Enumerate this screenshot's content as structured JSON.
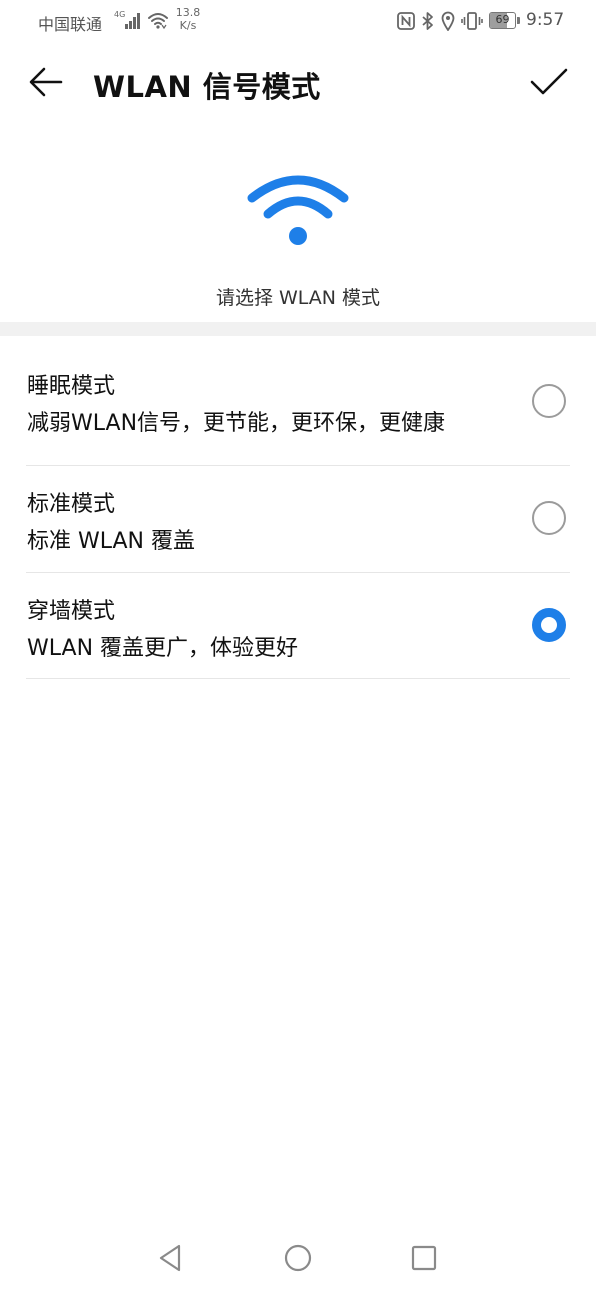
{
  "status_bar": {
    "carrier": "中国联通",
    "network_type": "4G",
    "speed_value": "13.8",
    "speed_unit": "K/s",
    "battery_level": "69",
    "battery_fraction": 0.69,
    "time": "9:57",
    "icons": [
      "signal-icon",
      "wifi-icon",
      "nfc-icon",
      "bluetooth-icon",
      "location-icon",
      "vibrate-icon",
      "battery-icon"
    ]
  },
  "header": {
    "title": "WLAN 信号模式"
  },
  "intro": {
    "hint": "请选择 WLAN 模式"
  },
  "modes": [
    {
      "title": "睡眠模式",
      "description": "减弱WLAN信号，更节能，更环保，更健康",
      "selected": false
    },
    {
      "title": "标准模式",
      "description": "标准 WLAN 覆盖",
      "selected": false
    },
    {
      "title": "穿墙模式",
      "description": "WLAN 覆盖更广，体验更好",
      "selected": true
    }
  ],
  "colors": {
    "accent": "#1e7fe8",
    "divider": "#e6e6e6",
    "section_gap": "#f1f1f1"
  }
}
